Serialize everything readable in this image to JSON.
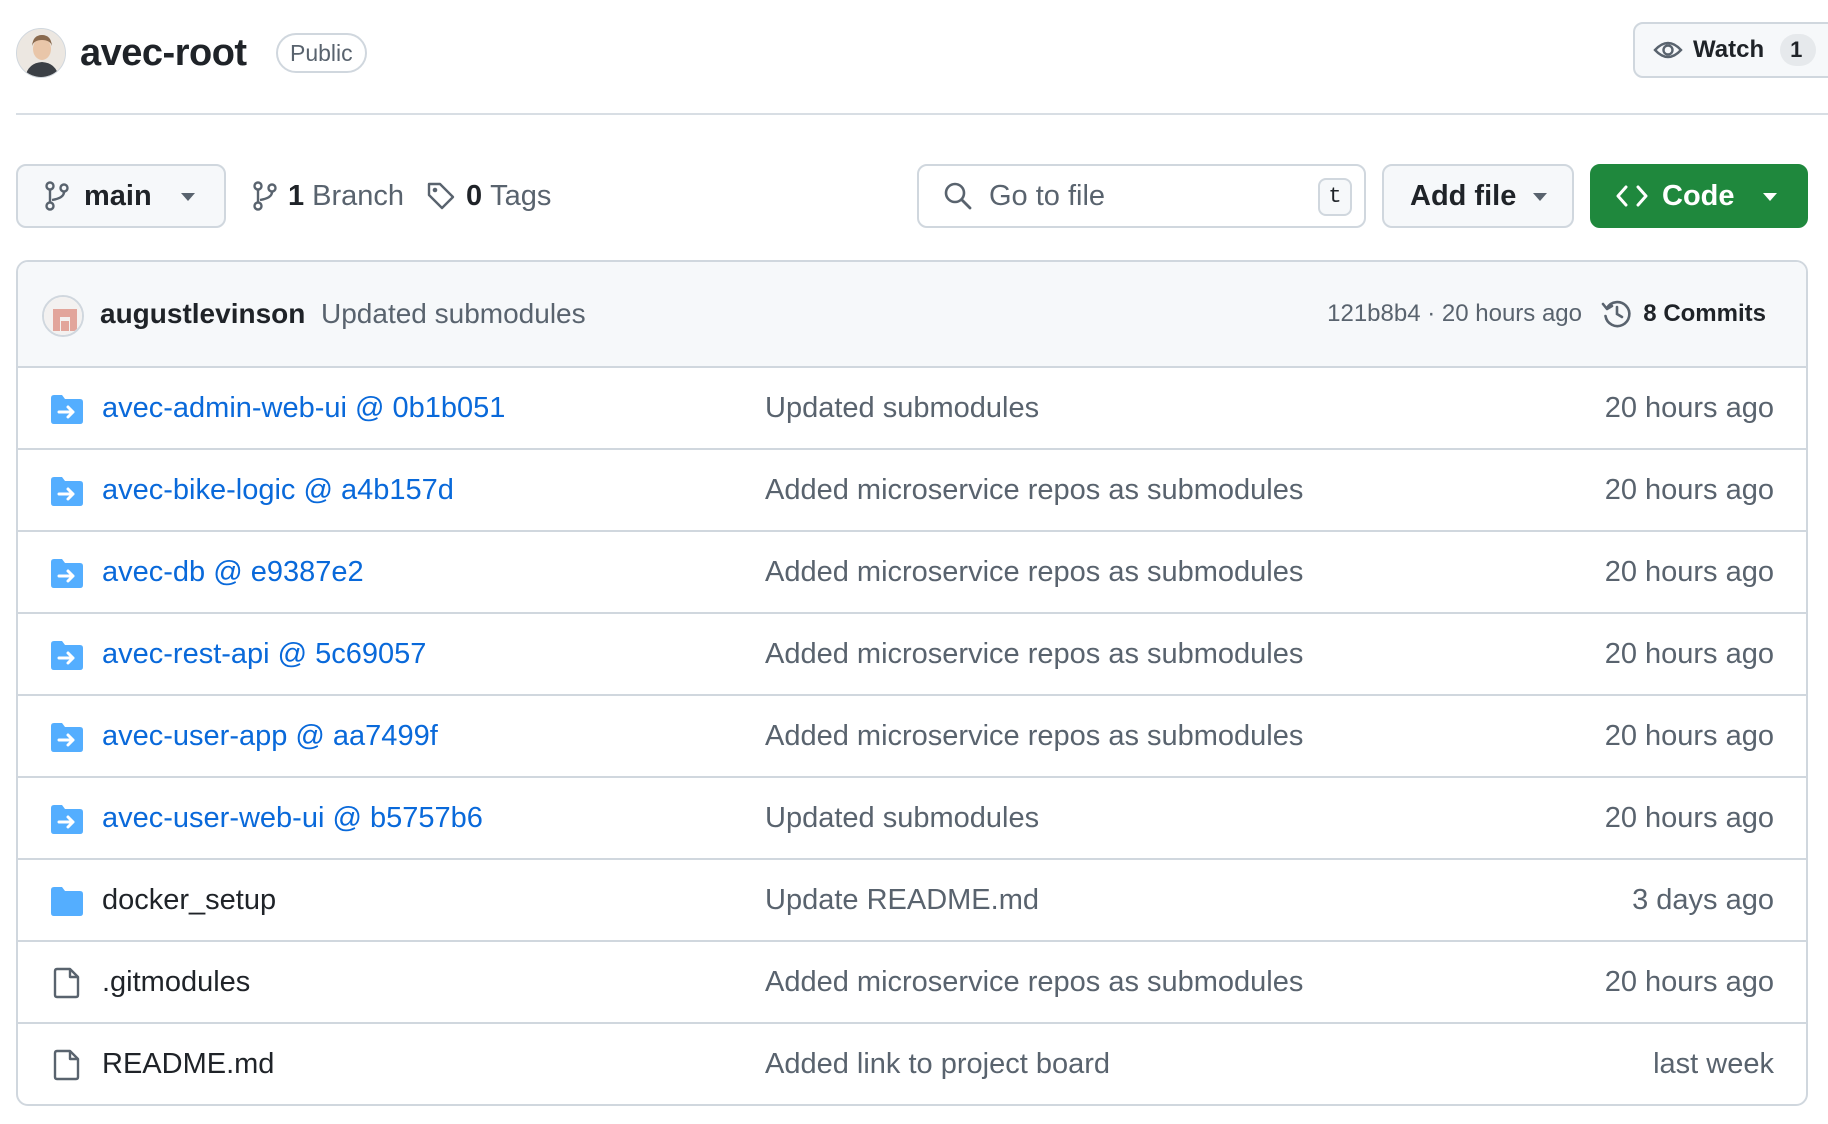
{
  "header": {
    "repo_name": "avec-root",
    "visibility": "Public",
    "watch_label": "Watch",
    "watch_count": "1"
  },
  "toolbar": {
    "branch": "main",
    "branch_count": "1",
    "branch_label": "Branch",
    "tag_count": "0",
    "tag_label": "Tags",
    "search_placeholder": "Go to file",
    "search_shortcut": "t",
    "add_file_label": "Add file",
    "code_label": "Code"
  },
  "latest_commit": {
    "author": "augustlevinson",
    "message": "Updated submodules",
    "hash_and_time": "121b8b4 · 20 hours ago",
    "commits_label": "8 Commits"
  },
  "files": [
    {
      "name": "avec-admin-web-ui @ 0b1b051",
      "type": "submodule",
      "message": "Updated submodules",
      "time": "20 hours ago"
    },
    {
      "name": "avec-bike-logic @ a4b157d",
      "type": "submodule",
      "message": "Added microservice repos as submodules",
      "time": "20 hours ago"
    },
    {
      "name": "avec-db @ e9387e2",
      "type": "submodule",
      "message": "Added microservice repos as submodules",
      "time": "20 hours ago"
    },
    {
      "name": "avec-rest-api @ 5c69057",
      "type": "submodule",
      "message": "Added microservice repos as submodules",
      "time": "20 hours ago"
    },
    {
      "name": "avec-user-app @ aa7499f",
      "type": "submodule",
      "message": "Added microservice repos as submodules",
      "time": "20 hours ago"
    },
    {
      "name": "avec-user-web-ui @ b5757b6",
      "type": "submodule",
      "message": "Updated submodules",
      "time": "20 hours ago"
    },
    {
      "name": "docker_setup",
      "type": "folder",
      "message": "Update README.md",
      "time": "3 days ago"
    },
    {
      "name": ".gitmodules",
      "type": "file",
      "message": "Added microservice repos as submodules",
      "time": "20 hours ago"
    },
    {
      "name": "README.md",
      "type": "file",
      "message": "Added link to project board",
      "time": "last week"
    }
  ],
  "colors": {
    "link": "#0969da",
    "folder": "#54aeff",
    "primary_button": "#1f883d",
    "muted_text": "#59636e",
    "border": "#d0d7de"
  }
}
